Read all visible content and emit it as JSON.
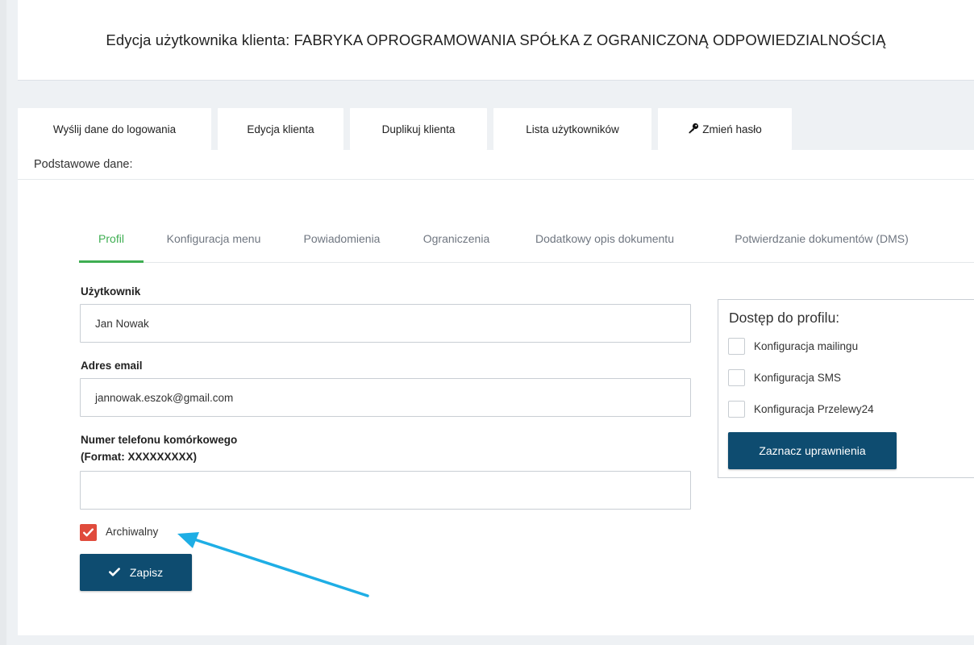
{
  "header": {
    "title": "Edycja użytkownika klienta: FABRYKA OPROGRAMOWANIA SPÓŁKA Z OGRANICZONĄ ODPOWIEDZIALNOŚCIĄ"
  },
  "actions": [
    {
      "label": "Wyślij dane do logowania"
    },
    {
      "label": "Edycja klienta"
    },
    {
      "label": "Duplikuj klienta"
    },
    {
      "label": "Lista użytkowników"
    },
    {
      "label": "Zmień hasło",
      "icon": "key-icon"
    }
  ],
  "section": {
    "title": "Podstawowe dane:"
  },
  "subtabs": [
    {
      "label": "Profil",
      "active": true
    },
    {
      "label": "Konfiguracja menu"
    },
    {
      "label": "Powiadomienia"
    },
    {
      "label": "Ograniczenia"
    },
    {
      "label": "Dodatkowy opis dokumentu"
    },
    {
      "label": "Potwierdzanie dokumentów (DMS)"
    }
  ],
  "form": {
    "user_label": "Użytkownik",
    "user_value": "Jan Nowak",
    "email_label": "Adres email",
    "email_value": "jannowak.eszok@gmail.com",
    "phone_label_line1": "Numer telefonu komórkowego",
    "phone_label_line2": "(Format: XXXXXXXXX)",
    "phone_value": "",
    "archive_label": "Archiwalny",
    "archive_checked": true,
    "save_label": "Zapisz"
  },
  "profile_access": {
    "title": "Dostęp do profilu:",
    "options": [
      {
        "label": "Konfiguracja mailingu",
        "checked": false
      },
      {
        "label": "Konfiguracja SMS",
        "checked": false
      },
      {
        "label": "Konfiguracja Przelewy24",
        "checked": false
      }
    ],
    "button_label": "Zaznacz uprawnienia"
  },
  "colors": {
    "accent_green": "#3fae52",
    "primary_button": "#0e4c70",
    "checkbox_checked": "#e04b3c",
    "annotation_arrow": "#1eaee5"
  }
}
